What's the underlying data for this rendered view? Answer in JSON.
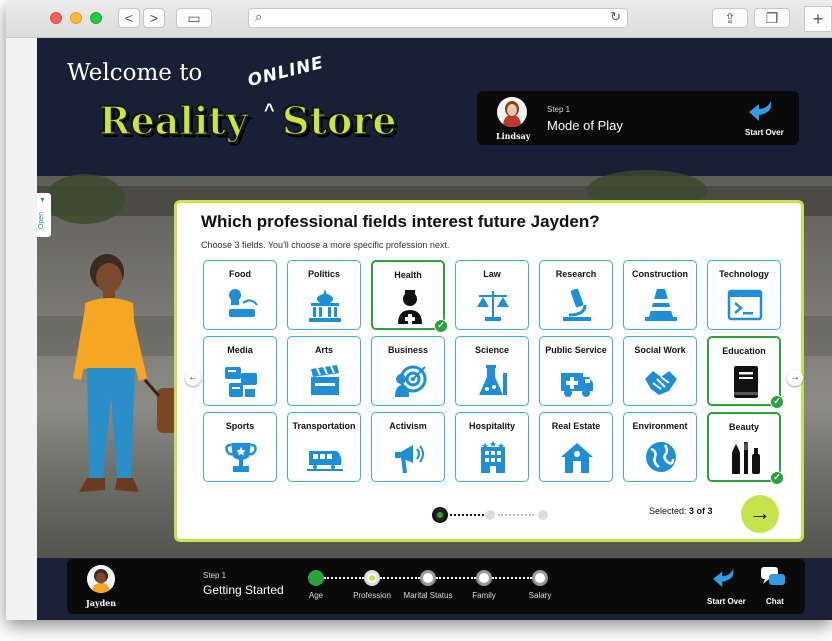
{
  "browser": {
    "back": "<",
    "forward": ">",
    "sidebar_glyph": "▭",
    "search_glyph": "⌕",
    "reload_glyph": "↻",
    "share_glyph": "⇪",
    "tabs_glyph": "❐",
    "new_tab_glyph": "+"
  },
  "header": {
    "welcome": "Welcome to",
    "logo_reality": "Reality",
    "logo_online": "ONLINE",
    "logo_caret": "^",
    "logo_store": "Store"
  },
  "mode_panel": {
    "user_name": "Lindsay",
    "step_label": "Step 1",
    "step_title": "Mode of Play",
    "start_over": "Start Over"
  },
  "side_tab": {
    "label": "Open",
    "arrow": "▼"
  },
  "card": {
    "title": "Which professional fields interest future Jayden?",
    "subtitle": "Choose 3 fields. You'll choose a more specific profession next.",
    "selected_prefix": "Selected: ",
    "selected_count": "3 of 3",
    "next_glyph": "→",
    "prev_glyph": "←",
    "fwd_glyph": "→"
  },
  "fields": [
    {
      "label": "Food",
      "icon": "chef-icon",
      "selected": false
    },
    {
      "label": "Politics",
      "icon": "capitol-icon",
      "selected": false
    },
    {
      "label": "Health",
      "icon": "nurse-icon",
      "selected": true
    },
    {
      "label": "Law",
      "icon": "scales-icon",
      "selected": false
    },
    {
      "label": "Research",
      "icon": "microscope-icon",
      "selected": false
    },
    {
      "label": "Construction",
      "icon": "traffic-cone-icon",
      "selected": false
    },
    {
      "label": "Technology",
      "icon": "terminal-icon",
      "selected": false
    },
    {
      "label": "Media",
      "icon": "media-icon",
      "selected": false
    },
    {
      "label": "Arts",
      "icon": "clapperboard-icon",
      "selected": false
    },
    {
      "label": "Business",
      "icon": "target-icon",
      "selected": false
    },
    {
      "label": "Science",
      "icon": "lab-flask-icon",
      "selected": false
    },
    {
      "label": "Public Service",
      "icon": "ambulance-icon",
      "selected": false
    },
    {
      "label": "Social Work",
      "icon": "handshake-icon",
      "selected": false
    },
    {
      "label": "Education",
      "icon": "book-icon",
      "selected": true
    },
    {
      "label": "Sports",
      "icon": "trophy-icon",
      "selected": false
    },
    {
      "label": "Transportation",
      "icon": "train-icon",
      "selected": false
    },
    {
      "label": "Activism",
      "icon": "megaphone-icon",
      "selected": false
    },
    {
      "label": "Hospitality",
      "icon": "hotel-icon",
      "selected": false
    },
    {
      "label": "Real Estate",
      "icon": "house-icon",
      "selected": false
    },
    {
      "label": "Environment",
      "icon": "globe-icon",
      "selected": false
    },
    {
      "label": "Beauty",
      "icon": "makeup-icon",
      "selected": true
    }
  ],
  "pager": {
    "pages": 3,
    "current": 1
  },
  "bottom_bar": {
    "user_name": "Jayden",
    "step_label": "Step 1",
    "step_title": "Getting Started",
    "steps": [
      {
        "label": "Age",
        "state": "done"
      },
      {
        "label": "Profession",
        "state": "current"
      },
      {
        "label": "Marital Status",
        "state": "todo"
      },
      {
        "label": "Family",
        "state": "todo"
      },
      {
        "label": "Salary",
        "state": "todo"
      }
    ],
    "start_over": "Start Over",
    "chat": "Chat"
  },
  "colors": {
    "brand_lime": "#c5e34a",
    "navy": "#172036",
    "tile_blue": "#1e8fd6",
    "selected_green": "#2aa33a"
  }
}
